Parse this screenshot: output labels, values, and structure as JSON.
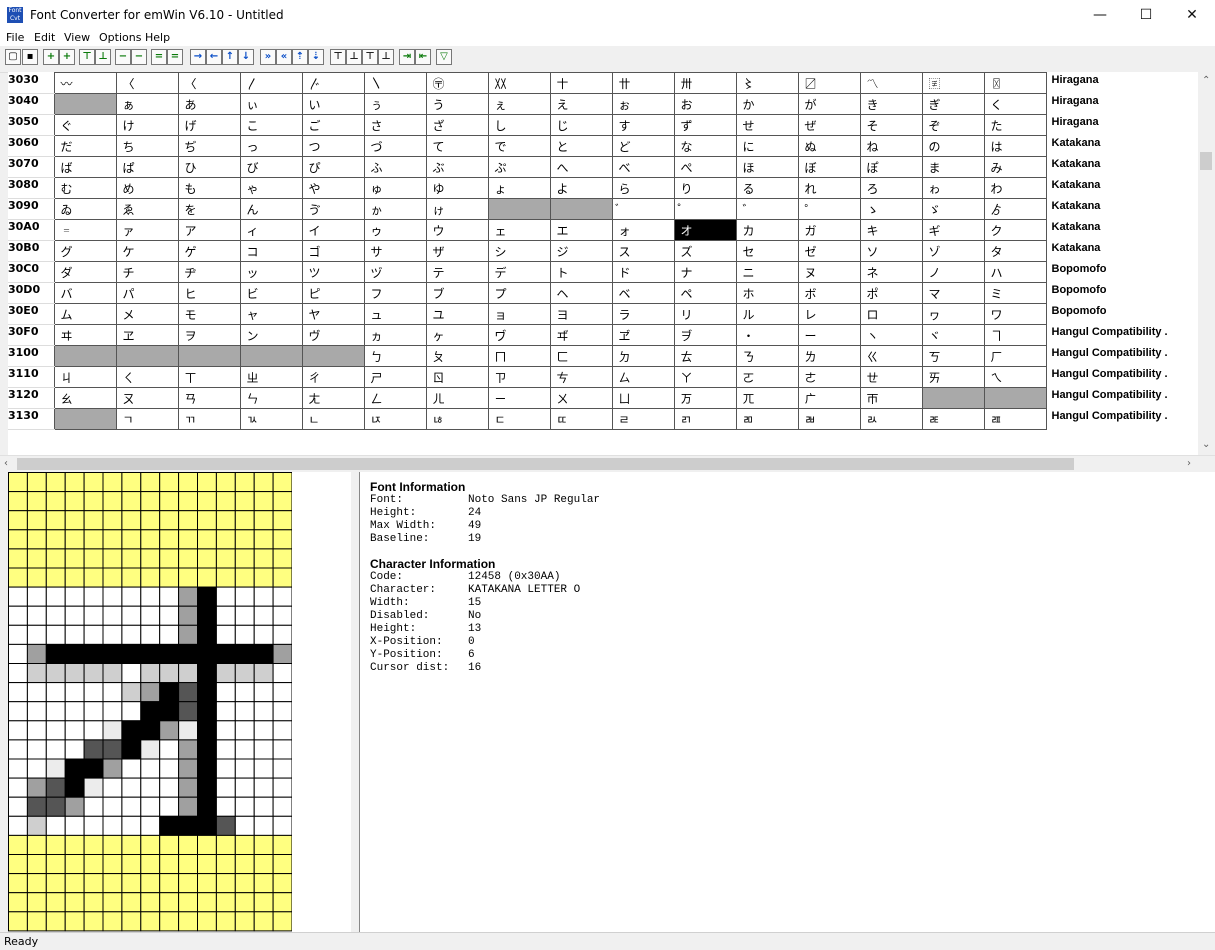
{
  "window": {
    "title": "Font Converter for emWin V6.10 - Untitled",
    "minimize": "—",
    "maximize": "☐",
    "close": "✕"
  },
  "menu": [
    "File",
    "Edit",
    "View",
    "Options",
    "Help"
  ],
  "toolbar": [
    "new",
    "save",
    "insert-col-left",
    "insert-col-right",
    "insert-row-top",
    "insert-row-bottom",
    "delete-col-left",
    "delete-col-right",
    "delete-row-top",
    "delete-row-bottom",
    "move-right",
    "move-left",
    "move-up",
    "move-down",
    "move-right-fast",
    "move-left-fast",
    "move-up-fast",
    "move-down-fast",
    "align-top",
    "align-bottom",
    "align-top-2",
    "align-bottom-2",
    "shift-right",
    "shift-left",
    "filter"
  ],
  "grid": {
    "rows": [
      {
        "code": "3030",
        "cells": [
          "〰",
          "〈",
          "〈",
          "〳",
          "〴",
          "〵",
          "〶",
          "〷",
          "〸",
          "〹",
          "〺",
          "〻",
          "〼",
          "〽",
          "〾",
          "〿"
        ],
        "range": "Hiragana"
      },
      {
        "code": "3040",
        "cells": [
          "",
          "ぁ",
          "あ",
          "ぃ",
          "い",
          "ぅ",
          "う",
          "ぇ",
          "え",
          "ぉ",
          "お",
          "か",
          "が",
          "き",
          "ぎ",
          "く"
        ],
        "range": "Hiragana"
      },
      {
        "code": "3050",
        "cells": [
          "ぐ",
          "け",
          "げ",
          "こ",
          "ご",
          "さ",
          "ざ",
          "し",
          "じ",
          "す",
          "ず",
          "せ",
          "ぜ",
          "そ",
          "ぞ",
          "た"
        ],
        "range": "Hiragana"
      },
      {
        "code": "3060",
        "cells": [
          "だ",
          "ち",
          "ぢ",
          "っ",
          "つ",
          "づ",
          "て",
          "で",
          "と",
          "ど",
          "な",
          "に",
          "ぬ",
          "ね",
          "の",
          "は"
        ],
        "range": "Katakana"
      },
      {
        "code": "3070",
        "cells": [
          "ば",
          "ぱ",
          "ひ",
          "び",
          "ぴ",
          "ふ",
          "ぶ",
          "ぷ",
          "へ",
          "べ",
          "ぺ",
          "ほ",
          "ぼ",
          "ぽ",
          "ま",
          "み"
        ],
        "range": "Katakana"
      },
      {
        "code": "3080",
        "cells": [
          "む",
          "め",
          "も",
          "ゃ",
          "や",
          "ゅ",
          "ゆ",
          "ょ",
          "よ",
          "ら",
          "り",
          "る",
          "れ",
          "ろ",
          "ゎ",
          "わ"
        ],
        "range": "Katakana"
      },
      {
        "code": "3090",
        "cells": [
          "ゐ",
          "ゑ",
          "を",
          "ん",
          "ゔ",
          "ゕ",
          "ゖ",
          "",
          "",
          "゙",
          "゚",
          "゛",
          "゜",
          "ゝ",
          "ゞ",
          "ゟ"
        ],
        "range": "Katakana"
      },
      {
        "code": "30A0",
        "cells": [
          "゠",
          "ァ",
          "ア",
          "ィ",
          "イ",
          "ゥ",
          "ウ",
          "ェ",
          "エ",
          "ォ",
          "オ",
          "カ",
          "ガ",
          "キ",
          "ギ",
          "ク"
        ],
        "range": "Katakana"
      },
      {
        "code": "30B0",
        "cells": [
          "グ",
          "ケ",
          "ゲ",
          "コ",
          "ゴ",
          "サ",
          "ザ",
          "シ",
          "ジ",
          "ス",
          "ズ",
          "セ",
          "ゼ",
          "ソ",
          "ゾ",
          "タ"
        ],
        "range": "Katakana"
      },
      {
        "code": "30C0",
        "cells": [
          "ダ",
          "チ",
          "ヂ",
          "ッ",
          "ツ",
          "ヅ",
          "テ",
          "デ",
          "ト",
          "ド",
          "ナ",
          "ニ",
          "ヌ",
          "ネ",
          "ノ",
          "ハ"
        ],
        "range": "Bopomofo"
      },
      {
        "code": "30D0",
        "cells": [
          "バ",
          "パ",
          "ヒ",
          "ビ",
          "ピ",
          "フ",
          "ブ",
          "プ",
          "ヘ",
          "ベ",
          "ペ",
          "ホ",
          "ボ",
          "ポ",
          "マ",
          "ミ"
        ],
        "range": "Bopomofo"
      },
      {
        "code": "30E0",
        "cells": [
          "ム",
          "メ",
          "モ",
          "ャ",
          "ヤ",
          "ュ",
          "ユ",
          "ョ",
          "ヨ",
          "ラ",
          "リ",
          "ル",
          "レ",
          "ロ",
          "ヮ",
          "ワ"
        ],
        "range": "Bopomofo"
      },
      {
        "code": "30F0",
        "cells": [
          "ヰ",
          "ヱ",
          "ヲ",
          "ン",
          "ヴ",
          "ヵ",
          "ヶ",
          "ヷ",
          "ヸ",
          "ヹ",
          "ヺ",
          "・",
          "ー",
          "ヽ",
          "ヾ",
          "ヿ"
        ],
        "range": "Hangul Compatibility ."
      },
      {
        "code": "3100",
        "cells": [
          "",
          "",
          "",
          "",
          "",
          "ㄅ",
          "ㄆ",
          "ㄇ",
          "ㄈ",
          "ㄉ",
          "ㄊ",
          "ㄋ",
          "ㄌ",
          "ㄍ",
          "ㄎ",
          "ㄏ"
        ],
        "range": "Hangul Compatibility ."
      },
      {
        "code": "3110",
        "cells": [
          "ㄐ",
          "ㄑ",
          "ㄒ",
          "ㄓ",
          "ㄔ",
          "ㄕ",
          "ㄖ",
          "ㄗ",
          "ㄘ",
          "ㄙ",
          "ㄚ",
          "ㄛ",
          "ㄜ",
          "ㄝ",
          "ㄞ",
          "ㄟ"
        ],
        "range": "Hangul Compatibility ."
      },
      {
        "code": "3120",
        "cells": [
          "ㄠ",
          "ㄡ",
          "ㄢ",
          "ㄣ",
          "ㄤ",
          "ㄥ",
          "ㄦ",
          "ㄧ",
          "ㄨ",
          "ㄩ",
          "ㄪ",
          "ㄫ",
          "ㄬ",
          "ㄭ",
          "",
          ""
        ],
        "range": "Hangul Compatibility ."
      },
      {
        "code": "3130",
        "cells": [
          "",
          "ㄱ",
          "ㄲ",
          "ㄳ",
          "ㄴ",
          "ㄵ",
          "ㄶ",
          "ㄷ",
          "ㄸ",
          "ㄹ",
          "ㄺ",
          "ㄻ",
          "ㄼ",
          "ㄽ",
          "ㄾ",
          "ㄿ"
        ],
        "range": "Hangul Compatibility ."
      }
    ],
    "disabled": [
      "3040-0",
      "3090-7",
      "3090-8",
      "3100-0",
      "3100-1",
      "3100-2",
      "3100-3",
      "3100-4",
      "3120-14",
      "3120-15",
      "3130-0"
    ],
    "selected": "30A0-10"
  },
  "preview": {
    "rows": [
      "WWWWWWWWWGBWWWW",
      "WWWWWWWWWGBWWWW",
      "WWWWWWWWWGBWWWW",
      "WGBBBBBBBBBBBBG",
      "WLLLLLWLLLBLLLW",
      "WWWWWWLGBDBWWWW",
      "WWWWWWWBBDBWWWW",
      "WWWWWEBBGEBWWWW",
      "WWWWDDBEWGBWWWW",
      "WWEBBGWWWGBWWWW",
      "WGDBEWWWWGBWWWW",
      "WDDGWWWWWGBWWWW",
      "WLWWWWWWBBBDWWW"
    ],
    "pad_top": 6,
    "pad_bottom": 5,
    "colors": {
      "W": "#ffffff",
      "E": "#ececec",
      "L": "#cfcfcf",
      "G": "#a0a0a0",
      "D": "#555555",
      "B": "#000000",
      "Y": "#ffff80"
    }
  },
  "font_info": {
    "heading": "Font Information",
    "rows": [
      {
        "k": "Font:",
        "v": "Noto Sans JP Regular"
      },
      {
        "k": "Height:",
        "v": "24"
      },
      {
        "k": "Max Width:",
        "v": "49"
      },
      {
        "k": "Baseline:",
        "v": "19"
      }
    ]
  },
  "char_info": {
    "heading": "Character Information",
    "rows": [
      {
        "k": "Code:",
        "v": "12458 (0x30AA)"
      },
      {
        "k": "Character:",
        "v": "KATAKANA LETTER O"
      },
      {
        "k": "Width:",
        "v": "15"
      },
      {
        "k": "Disabled:",
        "v": "No"
      },
      {
        "k": "Height:",
        "v": "13"
      },
      {
        "k": "X-Position:",
        "v": "0"
      },
      {
        "k": "Y-Position:",
        "v": "6"
      },
      {
        "k": "Cursor dist:",
        "v": "16"
      }
    ]
  },
  "status": "Ready"
}
